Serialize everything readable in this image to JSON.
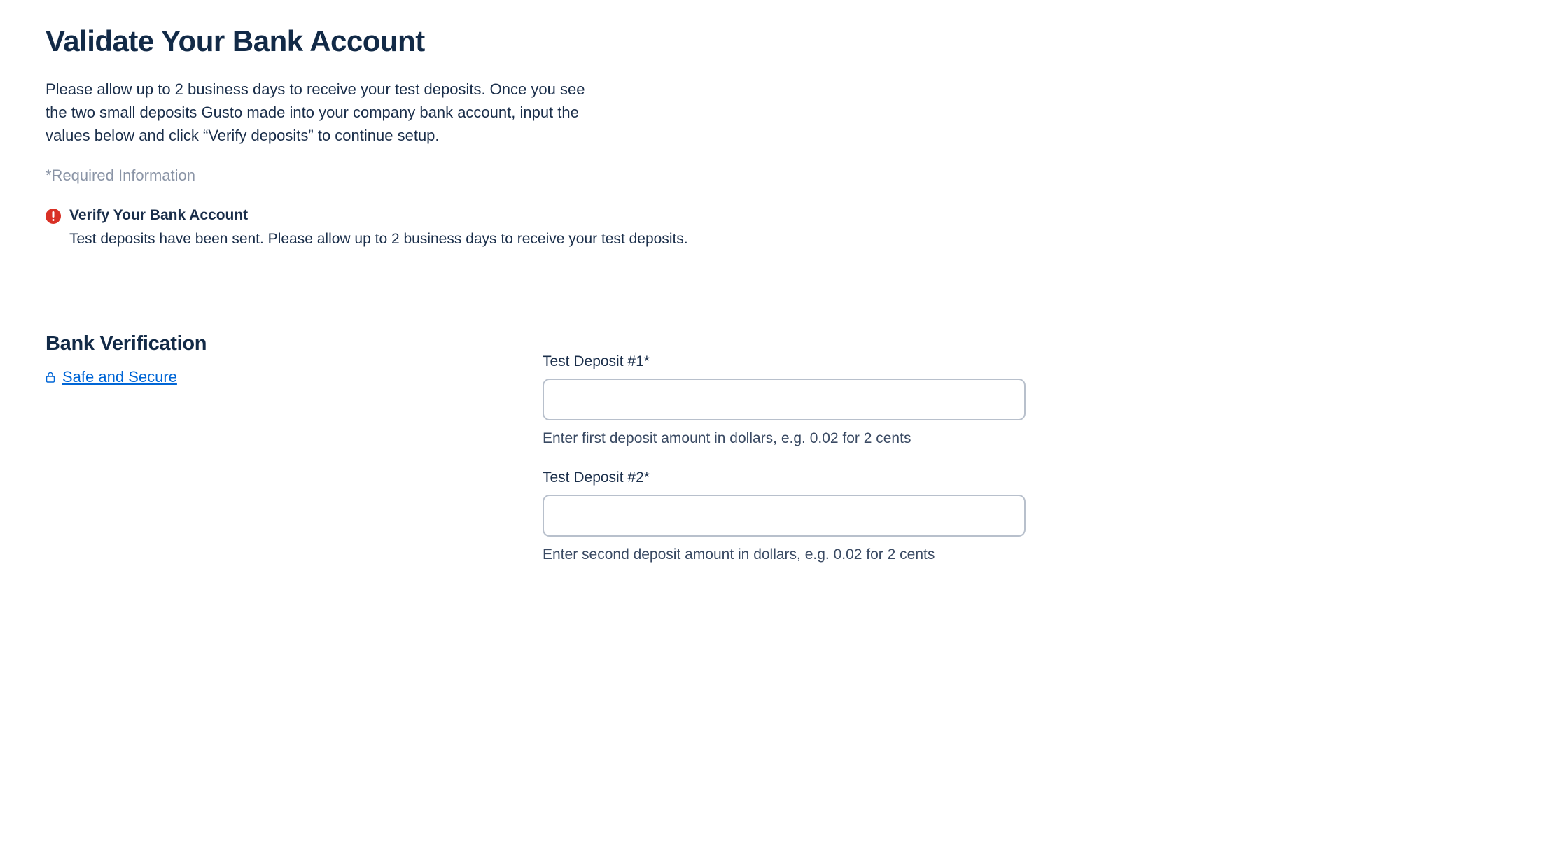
{
  "header": {
    "title": "Validate Your Bank Account",
    "intro": "Please allow up to 2 business days to receive your test deposits. Once you see the two small deposits Gusto made into your company bank account, input the values below and click “Verify deposits” to continue setup.",
    "required_note": "*Required Information"
  },
  "alert": {
    "title": "Verify Your Bank Account",
    "body": "Test deposits have been sent. Please allow up to 2 business days to receive your test deposits."
  },
  "section": {
    "heading": "Bank Verification",
    "safe_link": "Safe and Secure"
  },
  "fields": {
    "deposit1": {
      "label": "Test Deposit #1*",
      "value": "",
      "helper": "Enter first deposit amount in dollars, e.g. 0.02 for 2 cents"
    },
    "deposit2": {
      "label": "Test Deposit #2*",
      "value": "",
      "helper": "Enter second deposit amount in dollars, e.g. 0.02 for 2 cents"
    }
  }
}
